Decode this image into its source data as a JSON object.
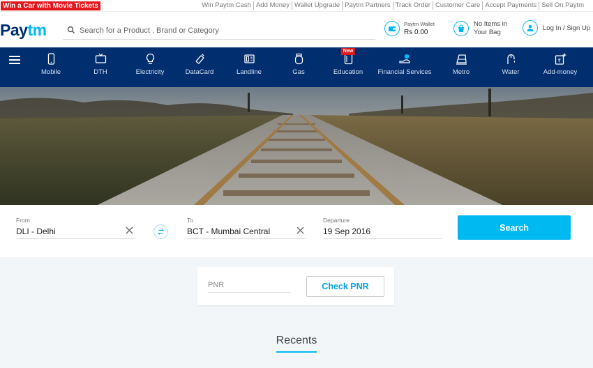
{
  "promo": {
    "label": "Win a Car with Movie Tickets"
  },
  "top_links": [
    "Win Paytm Cash",
    "Add Money",
    "Wallet Upgrade",
    "Paytm Partners",
    "Track Order",
    "Customer Care",
    "Accept Payments",
    "Sell On Paytm"
  ],
  "logo": {
    "part1": "Pay",
    "part2": "tm"
  },
  "search": {
    "placeholder": "Search for a Product , Brand or Category"
  },
  "wallet": {
    "label": "Paytm Wallet",
    "amount": "Rs 0.00"
  },
  "bag": {
    "line1": "No Items in",
    "line2": "Your Bag"
  },
  "login": {
    "label": "Log In / Sign Up"
  },
  "nav": {
    "items": [
      {
        "label": "Mobile",
        "icon": "mobile-icon"
      },
      {
        "label": "DTH",
        "icon": "tv-icon"
      },
      {
        "label": "Electricity",
        "icon": "bulb-icon"
      },
      {
        "label": "DataCard",
        "icon": "datacard-icon"
      },
      {
        "label": "Landline",
        "icon": "landline-icon"
      },
      {
        "label": "Gas",
        "icon": "gas-icon"
      },
      {
        "label": "Education",
        "icon": "education-icon",
        "badge": "New"
      },
      {
        "label": "Financial Services",
        "icon": "financial-icon"
      },
      {
        "label": "Metro",
        "icon": "metro-icon"
      },
      {
        "label": "Water",
        "icon": "water-icon"
      },
      {
        "label": "Add-money",
        "icon": "add-money-icon"
      }
    ]
  },
  "form": {
    "from_label": "From",
    "from_value": "DLI - Delhi",
    "to_label": "To",
    "to_value": "BCT - Mumbai Central",
    "departure_label": "Departure",
    "departure_value": "19 Sep 2016",
    "search_label": "Search"
  },
  "pnr": {
    "placeholder": "PNR",
    "button": "Check PNR"
  },
  "recents": {
    "title": "Recents"
  },
  "colors": {
    "brand_navy": "#002e6e",
    "brand_blue": "#00b9f1",
    "promo_red": "#e4161b"
  }
}
